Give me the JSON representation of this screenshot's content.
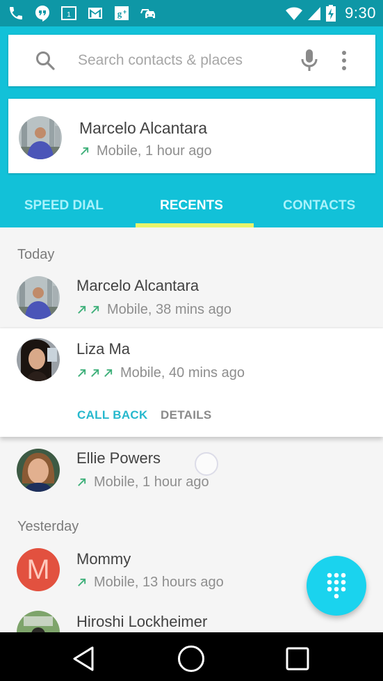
{
  "status_bar": {
    "left_icons": [
      "phone-icon",
      "hangouts-icon",
      "calendar-icon",
      "gmail-icon",
      "google-plus-icon",
      "car-icon"
    ],
    "calendar_day": "1",
    "right_icons": [
      "wifi-icon",
      "cell-signal-icon",
      "battery-charging-icon"
    ],
    "time": "9:30"
  },
  "colors": {
    "status_bar": "#0e97a6",
    "header": "#12c1d8",
    "tab_indicator": "#e8f46a",
    "fab": "#1ad3ee",
    "call_arrow": "#3fb07a",
    "call_back": "#26b8cd",
    "letter_avatar": "#e2513f"
  },
  "search": {
    "placeholder": "Search contacts & places",
    "value": ""
  },
  "favorite": {
    "name": "Marcelo Alcantara",
    "call_count": 1,
    "detail": "Mobile, 1 hour ago"
  },
  "tabs": [
    {
      "label": "SPEED DIAL",
      "active": false
    },
    {
      "label": "RECENTS",
      "active": true
    },
    {
      "label": "CONTACTS",
      "active": false
    }
  ],
  "sections": {
    "today": "Today",
    "yesterday": "Yesterday"
  },
  "recents": [
    {
      "name": "Marcelo Alcantara",
      "call_count": 2,
      "detail": "Mobile, 38 mins ago"
    },
    {
      "name": "Liza Ma",
      "call_count": 3,
      "detail": "Mobile, 40 mins ago",
      "expanded": true
    },
    {
      "name": "Ellie Powers",
      "call_count": 1,
      "detail": "Mobile, 1 hour ago"
    },
    {
      "name": "Mommy",
      "initial": "M",
      "call_count": 1,
      "detail": "Mobile, 13 hours ago"
    },
    {
      "name": "Hiroshi Lockheimer"
    }
  ],
  "actions": {
    "call_back": "CALL BACK",
    "details": "DETAILS"
  },
  "fab": {
    "icon": "dialpad-icon"
  },
  "nav": [
    "back-icon",
    "home-icon",
    "recents-icon"
  ]
}
